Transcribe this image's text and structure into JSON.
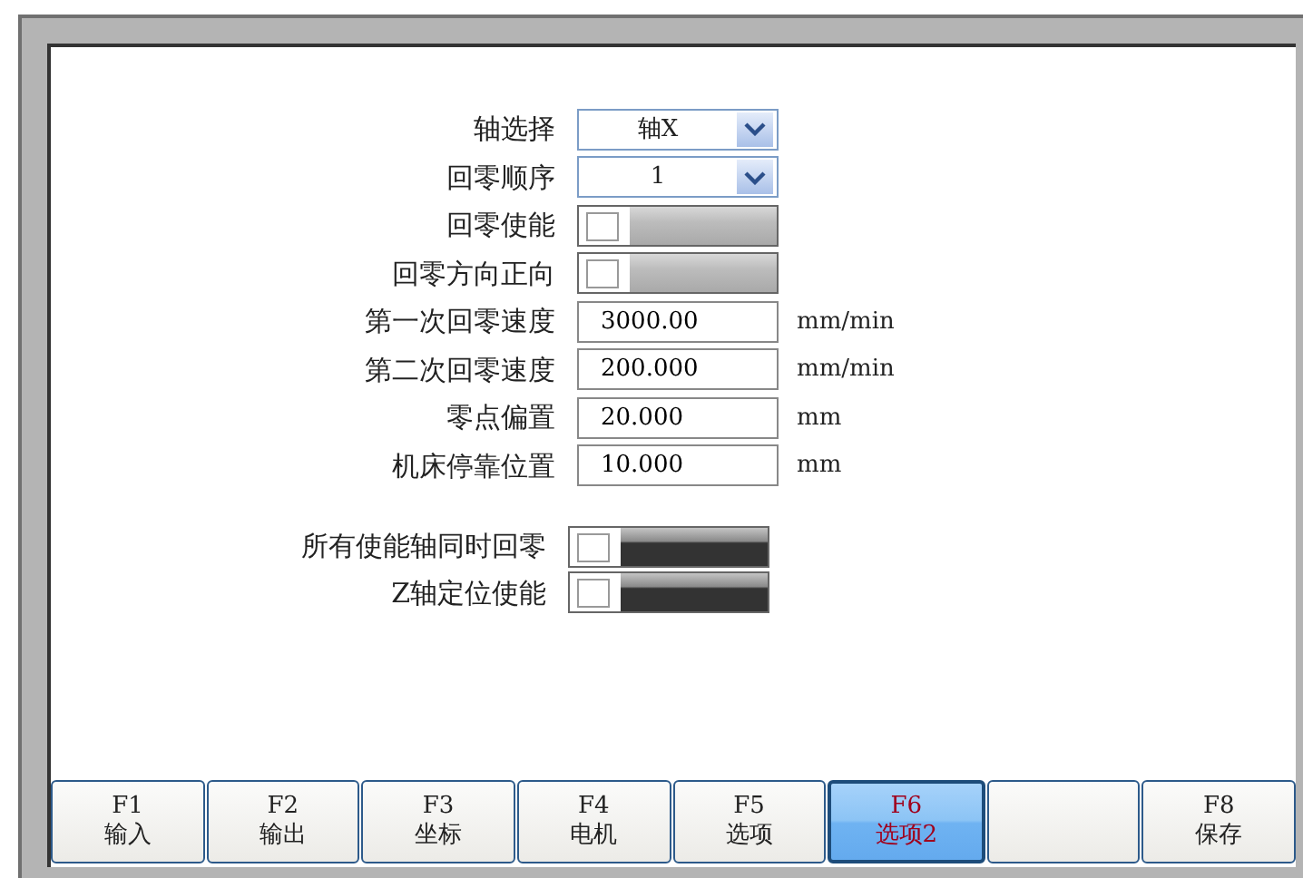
{
  "settings": [
    {
      "label": "轴选择",
      "kind": "select",
      "value": "轴X"
    },
    {
      "label": "回零顺序",
      "kind": "select",
      "value": "1"
    },
    {
      "label": "回零使能",
      "kind": "toggle",
      "checked": false
    },
    {
      "label": "回零方向正向",
      "kind": "toggle",
      "checked": false
    },
    {
      "label": "第一次回零速度",
      "kind": "number",
      "value": "3000.00",
      "unit": "mm/min"
    },
    {
      "label": "第二次回零速度",
      "kind": "number",
      "value": "200.000",
      "unit": "mm/min"
    },
    {
      "label": "零点偏置",
      "kind": "number",
      "value": "20.000",
      "unit": "mm"
    },
    {
      "label": "机床停靠位置",
      "kind": "number",
      "value": "10.000",
      "unit": "mm"
    }
  ],
  "extra_settings": [
    {
      "label": "所有使能轴同时回零",
      "kind": "darktoggle",
      "checked": false
    },
    {
      "label": "Z轴定位使能",
      "kind": "darktoggle",
      "checked": false
    }
  ],
  "function_keys": [
    {
      "key": "F1",
      "label": "输入",
      "selected": false
    },
    {
      "key": "F2",
      "label": "输出",
      "selected": false
    },
    {
      "key": "F3",
      "label": "坐标",
      "selected": false
    },
    {
      "key": "F4",
      "label": "电机",
      "selected": false
    },
    {
      "key": "F5",
      "label": "选项",
      "selected": false
    },
    {
      "key": "F6",
      "label": "选项2",
      "selected": true
    },
    {
      "selected": false
    },
    {
      "key": "F8",
      "label": "保存",
      "selected": false
    }
  ]
}
